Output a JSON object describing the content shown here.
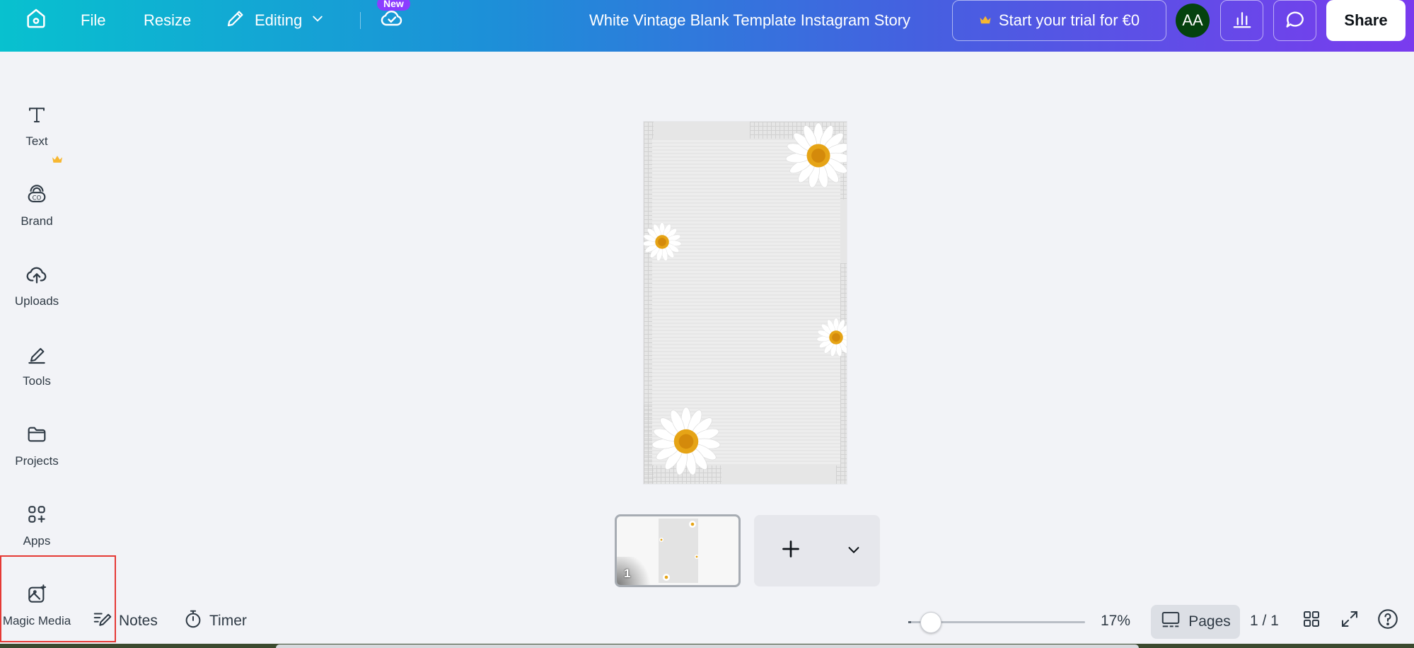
{
  "topbar": {
    "file_label": "File",
    "resize_label": "Resize",
    "editing_label": "Editing",
    "new_badge": "New",
    "doc_title": "White Vintage Blank Template Instagram Story",
    "trial_label": "Start your trial for €0",
    "avatar_initials": "AA",
    "share_label": "Share"
  },
  "sidebar": {
    "items": [
      {
        "label": "Text",
        "icon": "text-icon"
      },
      {
        "label": "Brand",
        "icon": "brand-icon"
      },
      {
        "label": "Uploads",
        "icon": "cloud-upload-icon"
      },
      {
        "label": "Tools",
        "icon": "pen-tool-icon"
      },
      {
        "label": "Projects",
        "icon": "folder-icon"
      },
      {
        "label": "Apps",
        "icon": "apps-icon"
      },
      {
        "label": "Magic Media",
        "icon": "magic-media-icon"
      }
    ]
  },
  "pages": {
    "thumbnail_number": "1"
  },
  "bottombar": {
    "notes_label": "Notes",
    "timer_label": "Timer",
    "zoom_label": "17%",
    "zoom_value": 0.17,
    "pages_label": "Pages",
    "page_count": "1 / 1"
  },
  "colors": {
    "gradient_start": "#08c1cf",
    "gradient_end": "#7a3bee",
    "avatar_bg": "#04420e",
    "highlight": "#e53935"
  }
}
